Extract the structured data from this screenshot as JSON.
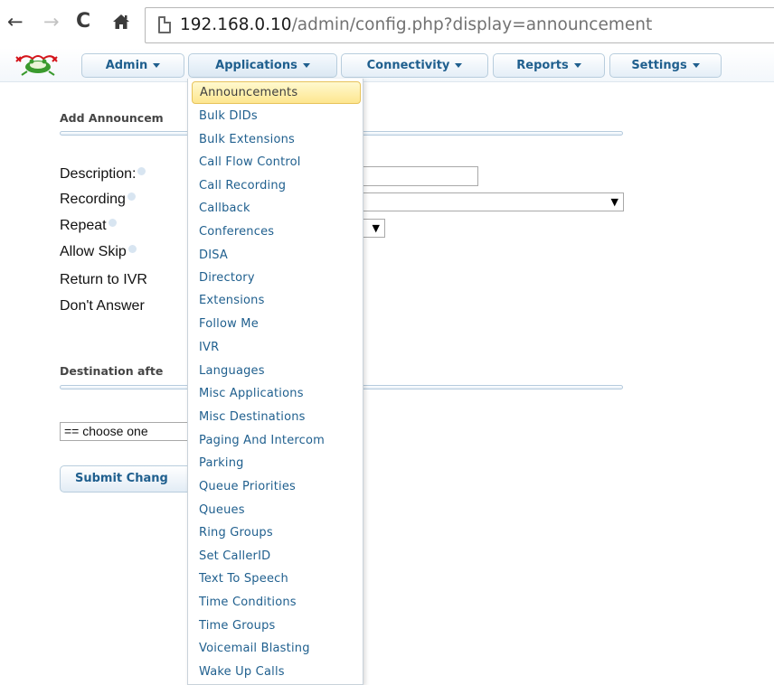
{
  "browser": {
    "back_icon": "back-arrow-icon",
    "forward_icon": "forward-arrow-icon",
    "reload_icon": "reload-icon",
    "home_icon": "home-icon",
    "url_host": "192.168.0.10",
    "url_path": "/admin/config.php?display=announcement"
  },
  "navbar": {
    "logo_icon": "frog-logo-icon",
    "menus": [
      {
        "label": "Admin"
      },
      {
        "label": "Applications"
      },
      {
        "label": "Connectivity"
      },
      {
        "label": "Reports"
      },
      {
        "label": "Settings"
      }
    ]
  },
  "form": {
    "section_title": "Add Announcem",
    "fields": {
      "description": "Description:",
      "recording": "Recording",
      "repeat": "Repeat",
      "allow_skip": "Allow Skip",
      "return_ivr": "Return to IVR",
      "dont_answer": "Don't Answer"
    },
    "destination_title": "Destination afte",
    "destination_select": "== choose one",
    "submit_label": "Submit Chang"
  },
  "dropdown": {
    "items": [
      "Announcements",
      "Bulk DIDs",
      "Bulk Extensions",
      "Call Flow Control",
      "Call Recording",
      "Callback",
      "Conferences",
      "DISA",
      "Directory",
      "Extensions",
      "Follow Me",
      "IVR",
      "Languages",
      "Misc Applications",
      "Misc Destinations",
      "Paging And Intercom",
      "Parking",
      "Queue Priorities",
      "Queues",
      "Ring Groups",
      "Set CallerID",
      "Text To Speech",
      "Time Conditions",
      "Time Groups",
      "Voicemail Blasting",
      "Wake Up Calls"
    ],
    "highlighted_index": 0
  },
  "colors": {
    "menu_text": "#1f5f8e",
    "highlight_bg": "#fde68f",
    "highlight_border": "#e7c35b"
  }
}
